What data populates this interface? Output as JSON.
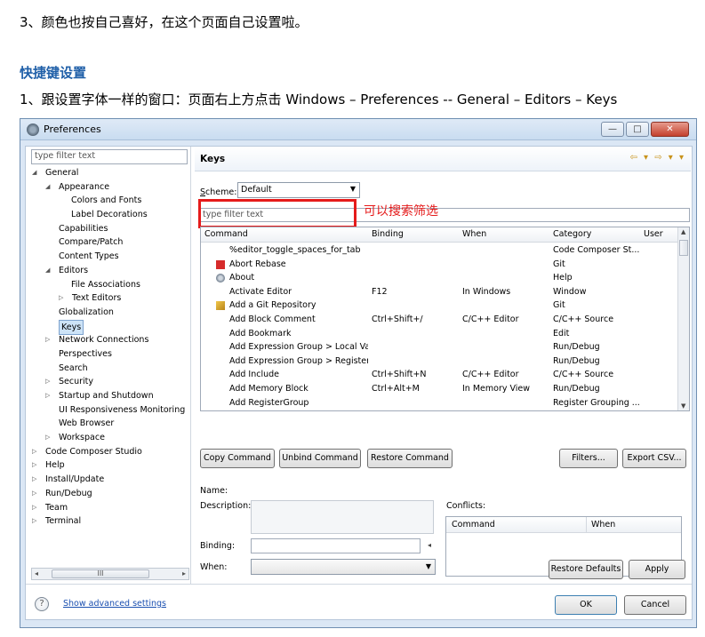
{
  "doc": {
    "line1": "3、颜色也按自己喜好，在这个页面自己设置啦。",
    "heading": "快捷键设置",
    "line2": "1、跟设置字体一样的窗口：页面右上方点击 Windows – Preferences -- General – Editors – Keys"
  },
  "window": {
    "title": "Preferences",
    "buttons": {
      "minimize": "—",
      "maximize": "□",
      "close": "✕"
    }
  },
  "tree": {
    "filter_placeholder": "type filter text",
    "nodes": [
      {
        "label": "General",
        "arrow": "◢"
      },
      {
        "label": "Appearance",
        "arrow": "◢"
      },
      {
        "label": "Colors and Fonts",
        "arrow": ""
      },
      {
        "label": "Label Decorations",
        "arrow": ""
      },
      {
        "label": "Capabilities",
        "arrow": ""
      },
      {
        "label": "Compare/Patch",
        "arrow": ""
      },
      {
        "label": "Content Types",
        "arrow": ""
      },
      {
        "label": "Editors",
        "arrow": "◢"
      },
      {
        "label": "File Associations",
        "arrow": ""
      },
      {
        "label": "Text Editors",
        "arrow": "▷"
      },
      {
        "label": "Globalization",
        "arrow": ""
      },
      {
        "label": "Keys",
        "arrow": ""
      },
      {
        "label": "Network Connections",
        "arrow": "▷"
      },
      {
        "label": "Perspectives",
        "arrow": ""
      },
      {
        "label": "Search",
        "arrow": ""
      },
      {
        "label": "Security",
        "arrow": "▷"
      },
      {
        "label": "Startup and Shutdown",
        "arrow": "▷"
      },
      {
        "label": "UI Responsiveness Monitoring",
        "arrow": ""
      },
      {
        "label": "Web Browser",
        "arrow": ""
      },
      {
        "label": "Workspace",
        "arrow": "▷"
      },
      {
        "label": "Code Composer Studio",
        "arrow": "▷"
      },
      {
        "label": "Help",
        "arrow": "▷"
      },
      {
        "label": "Install/Update",
        "arrow": "▷"
      },
      {
        "label": "Run/Debug",
        "arrow": "▷"
      },
      {
        "label": "Team",
        "arrow": "▷"
      },
      {
        "label": "Terminal",
        "arrow": "▷"
      }
    ],
    "scroll_thumb": "III"
  },
  "keys": {
    "title": "Keys",
    "nav": "⇦ ▾ ⇨ ▾ ▾",
    "scheme_label": "Scheme:",
    "scheme_value": "Default",
    "filter_placeholder": "type filter text",
    "annotation": "可以搜索筛选",
    "columns": [
      "Command",
      "Binding",
      "When",
      "Category",
      "User"
    ],
    "rows": [
      {
        "command": "%editor_toggle_spaces_for_tab",
        "binding": "",
        "when": "",
        "category": "Code Composer St...",
        "icon": ""
      },
      {
        "command": "Abort Rebase",
        "binding": "",
        "when": "",
        "category": "Git",
        "icon": "red-square"
      },
      {
        "command": "About",
        "binding": "",
        "when": "",
        "category": "Help",
        "icon": "gear"
      },
      {
        "command": "Activate Editor",
        "binding": "F12",
        "when": "In Windows",
        "category": "Window",
        "icon": ""
      },
      {
        "command": "Add a Git Repository",
        "binding": "",
        "when": "",
        "category": "Git",
        "icon": "repo"
      },
      {
        "command": "Add Block Comment",
        "binding": "Ctrl+Shift+/",
        "when": "C/C++ Editor",
        "category": "C/C++ Source",
        "icon": ""
      },
      {
        "command": "Add Bookmark",
        "binding": "",
        "when": "",
        "category": "Edit",
        "icon": ""
      },
      {
        "command": "Add Expression Group > Local Va",
        "binding": "",
        "when": "",
        "category": "Run/Debug",
        "icon": ""
      },
      {
        "command": "Add Expression Group > Register",
        "binding": "",
        "when": "",
        "category": "Run/Debug",
        "icon": ""
      },
      {
        "command": "Add Include",
        "binding": "Ctrl+Shift+N",
        "when": "C/C++ Editor",
        "category": "C/C++ Source",
        "icon": ""
      },
      {
        "command": "Add Memory Block",
        "binding": "Ctrl+Alt+M",
        "when": "In Memory View",
        "category": "Run/Debug",
        "icon": ""
      },
      {
        "command": "Add RegisterGroup",
        "binding": "",
        "when": "",
        "category": "Register Grouping ...",
        "icon": ""
      }
    ],
    "buttons": {
      "copy": "Copy Command",
      "unbind": "Unbind Command",
      "restore": "Restore Command",
      "filters": "Filters...",
      "export": "Export CSV..."
    },
    "name_label": "Name:",
    "description_label": "Description:",
    "binding_label": "Binding:",
    "when_label": "When:",
    "conflicts_label": "Conflicts:",
    "conflict_columns": [
      "Command",
      "When"
    ],
    "restore_defaults": "Restore Defaults",
    "apply": "Apply"
  },
  "footer": {
    "help_icon": "?",
    "advanced_link": "Show advanced settings",
    "ok": "OK",
    "cancel": "Cancel"
  }
}
